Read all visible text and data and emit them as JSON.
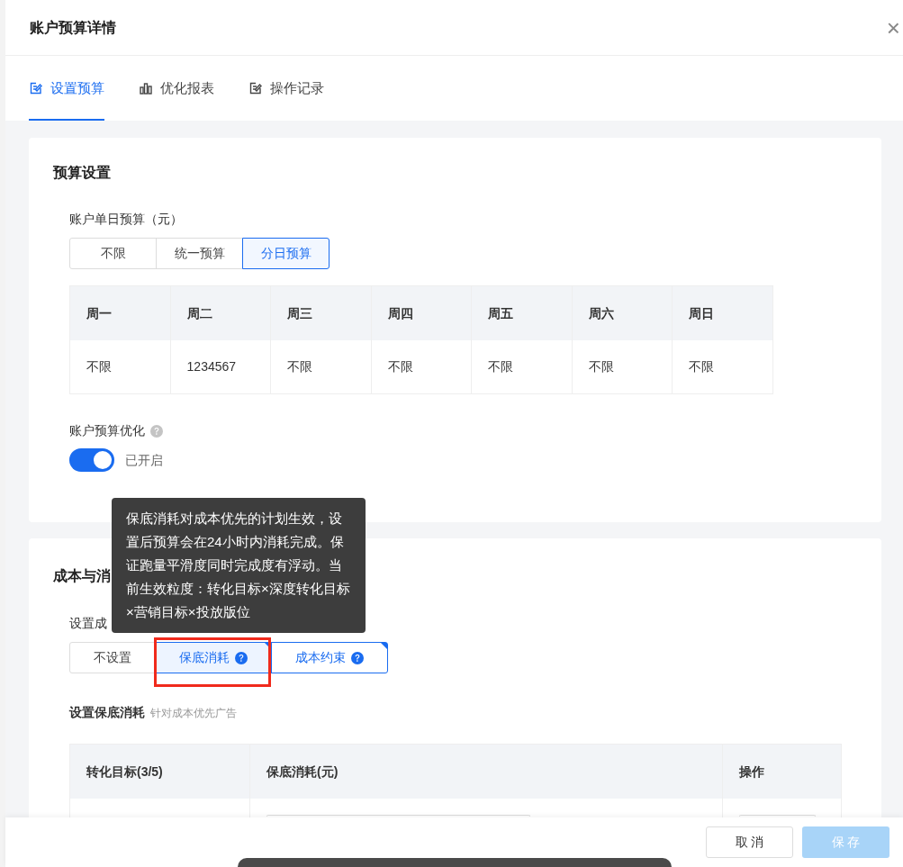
{
  "drawer": {
    "title": "账户预算详情",
    "close": "×"
  },
  "tabs": [
    {
      "label": "设置预算",
      "selected": true
    },
    {
      "label": "优化报表",
      "selected": false
    },
    {
      "label": "操作记录",
      "selected": false
    }
  ],
  "budget_card": {
    "title": "预算设置",
    "daily_label": "账户单日预算（元）",
    "modes": [
      {
        "label": "不限",
        "selected": false
      },
      {
        "label": "统一预算",
        "selected": false
      },
      {
        "label": "分日预算",
        "selected": true
      }
    ],
    "week_table": {
      "columns": [
        "周一",
        "周二",
        "周三",
        "周四",
        "周五",
        "周六",
        "周日"
      ],
      "values": [
        "不限",
        "1234567",
        "不限",
        "不限",
        "不限",
        "不限",
        "不限"
      ]
    },
    "optimize_label": "账户预算优化",
    "optimize": {
      "on": true,
      "text": "已开启"
    }
  },
  "cost_card": {
    "title": "成本与消",
    "setting_label": "设置成",
    "options": [
      {
        "label": "不设置",
        "selected": false,
        "help": false,
        "hovered": false,
        "annotated": false
      },
      {
        "label": "保底消耗",
        "selected": true,
        "help": true,
        "hovered": true,
        "annotated": true
      },
      {
        "label": "成本约束",
        "selected": true,
        "help": true,
        "hovered": false,
        "annotated": false
      }
    ],
    "tooltip": "保底消耗对成本优先的计划生效，设置后预算会在24小时内消耗完成。保证跑量平滑度同时完成度有浮动。当前生效粒度：转化目标×深度转化目标×营销目标×投放版位",
    "sub_label": "设置保底消耗",
    "sub_hint": "针对成本优先广告",
    "table_columns": [
      "转化目标(3/5)",
      "保底消耗(元)",
      "操作"
    ]
  },
  "footer": {
    "cancel": "取 消",
    "save": "保 存",
    "save_disabled": true
  }
}
